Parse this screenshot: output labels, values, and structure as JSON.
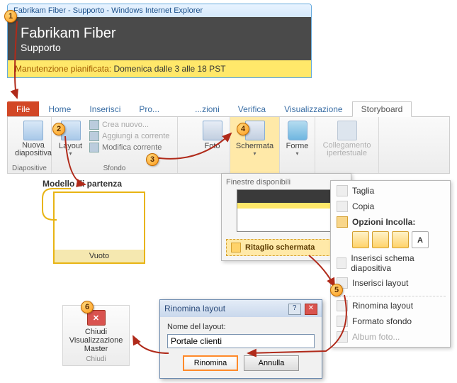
{
  "browser": {
    "title": "Fabrikam Fiber - Supporto - Windows Internet Explorer",
    "heading": "Fabrikam Fiber",
    "subheading": "Supporto",
    "maintenance_label": "Manutenzione pianificata:",
    "maintenance_value": "Domenica dalle 3 alle 18 PST"
  },
  "ribbon": {
    "tabs": {
      "file": "File",
      "home": "Home",
      "inserisci": "Inserisci",
      "pro": "Pro...",
      "zioni": "...zioni",
      "verifica": "Verifica",
      "visualizzazione": "Visualizzazione",
      "storyboard": "Storyboard"
    },
    "groups": {
      "diapositive": {
        "label": "Diapositive",
        "nuova": "Nuova diapositiva",
        "layout": "Layout"
      },
      "sfondo": {
        "label": "Sfondo",
        "crea": "Crea nuovo...",
        "aggiungi": "Aggiungi a corrente",
        "modifica": "Modifica corrente"
      },
      "foto": "Foto",
      "schermata": "Schermata",
      "forme": "Forme",
      "collegamento": "Collegamento ipertestuale"
    }
  },
  "schermata_dd": {
    "title": "Finestre disponibili",
    "ritaglio": "Ritaglio schermata"
  },
  "vuoto": {
    "heading": "Modello di partenza",
    "label": "Vuoto"
  },
  "context": {
    "taglia": "Taglia",
    "copia": "Copia",
    "opzioni": "Opzioni Incolla:",
    "inserisci_schema": "Inserisci schema diapositiva",
    "inserisci_layout": "Inserisci layout",
    "rinomina_layout": "Rinomina layout",
    "formato_sfondo": "Formato sfondo",
    "album": "Album foto..."
  },
  "dialog": {
    "title": "Rinomina layout",
    "field_label": "Nome del layout:",
    "field_value": "Portale clienti",
    "ok": "Rinomina",
    "cancel": "Annulla"
  },
  "close_master": {
    "line1": "Chiudi Visualizzazione Master",
    "line2": "Chiudi"
  },
  "callouts": [
    "1",
    "2",
    "3",
    "4",
    "5",
    "6"
  ]
}
